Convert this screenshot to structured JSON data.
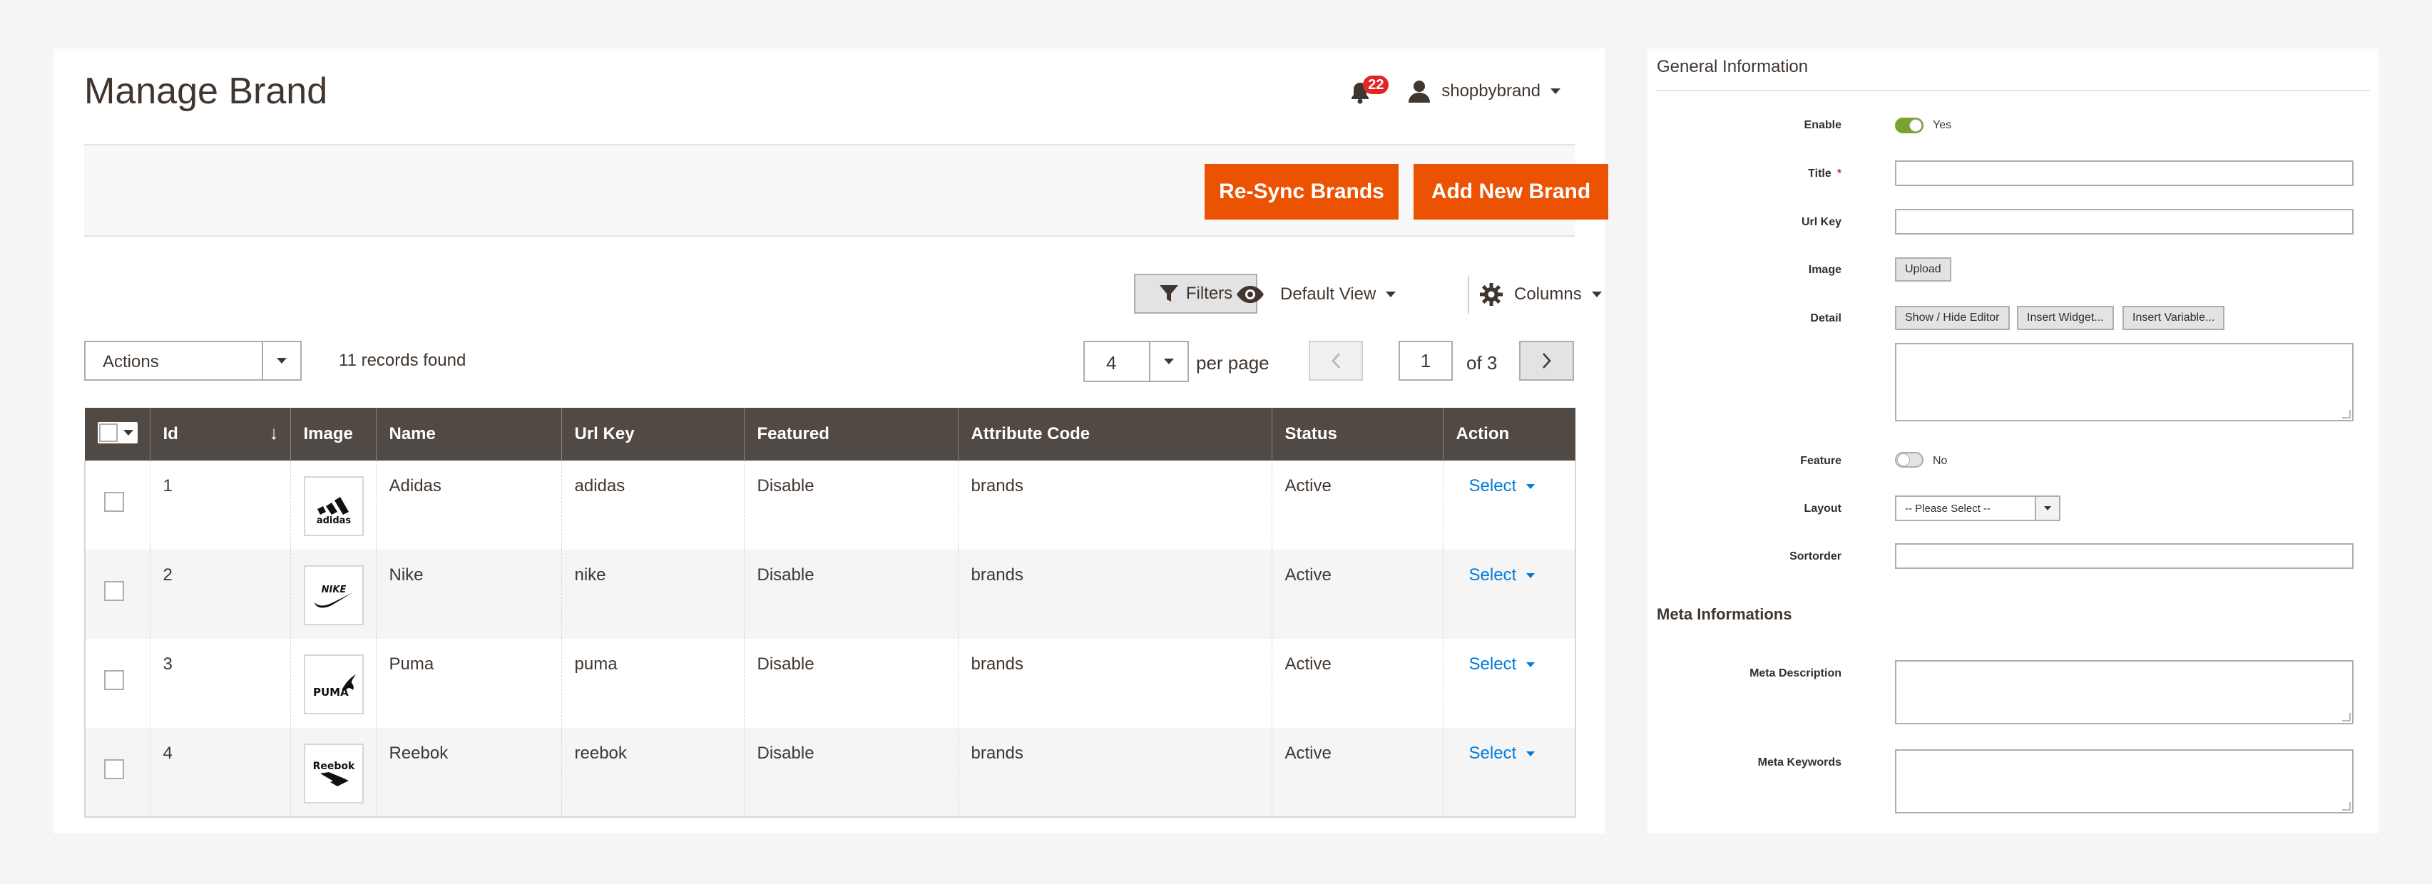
{
  "header": {
    "page_title": "Manage Brand",
    "notifications_count": "22",
    "user_name": "shopbybrand"
  },
  "action_bar": {
    "resync_label": "Re-Sync Brands",
    "add_label": "Add New Brand"
  },
  "toolbar": {
    "filters_label": "Filters",
    "default_view_label": "Default View",
    "columns_label": "Columns",
    "actions_label": "Actions",
    "records_found": "11 records found",
    "per_page_value": "4",
    "per_page_label": "per page",
    "current_page": "1",
    "of_pages": "of 3"
  },
  "grid": {
    "columns": [
      "Id",
      "Image",
      "Name",
      "Url Key",
      "Featured",
      "Attribute Code",
      "Status",
      "Action"
    ],
    "rows": [
      {
        "id": "1",
        "name": "Adidas",
        "url_key": "adidas",
        "featured": "Disable",
        "attribute_code": "brands",
        "status": "Active",
        "action": "Select",
        "logo": "adidas-logo-icon"
      },
      {
        "id": "2",
        "name": "Nike",
        "url_key": "nike",
        "featured": "Disable",
        "attribute_code": "brands",
        "status": "Active",
        "action": "Select",
        "logo": "nike-logo-icon"
      },
      {
        "id": "3",
        "name": "Puma",
        "url_key": "puma",
        "featured": "Disable",
        "attribute_code": "brands",
        "status": "Active",
        "action": "Select",
        "logo": "puma-logo-icon"
      },
      {
        "id": "4",
        "name": "Reebok",
        "url_key": "reebok",
        "featured": "Disable",
        "attribute_code": "brands",
        "status": "Active",
        "action": "Select",
        "logo": "reebok-logo-icon"
      }
    ]
  },
  "form": {
    "general_title": "General Information",
    "enable_label": "Enable",
    "enable_value": "Yes",
    "title_label": "Title",
    "title_required": "*",
    "url_key_label": "Url Key",
    "image_label": "Image",
    "upload_label": "Upload",
    "detail_label": "Detail",
    "show_hide_editor_label": "Show / Hide Editor",
    "insert_widget_label": "Insert Widget...",
    "insert_variable_label": "Insert Variable...",
    "feature_label": "Feature",
    "feature_value": "No",
    "layout_label": "Layout",
    "layout_value": "-- Please Select --",
    "sortorder_label": "Sortorder",
    "meta_title": "Meta Informations",
    "meta_description_label": "Meta Description",
    "meta_keywords_label": "Meta Keywords"
  },
  "colors": {
    "accent_orange": "#eb5202",
    "header_dark": "#514943",
    "link_blue": "#007bdb",
    "toggle_on": "#79a22e",
    "badge_red": "#e22626"
  }
}
